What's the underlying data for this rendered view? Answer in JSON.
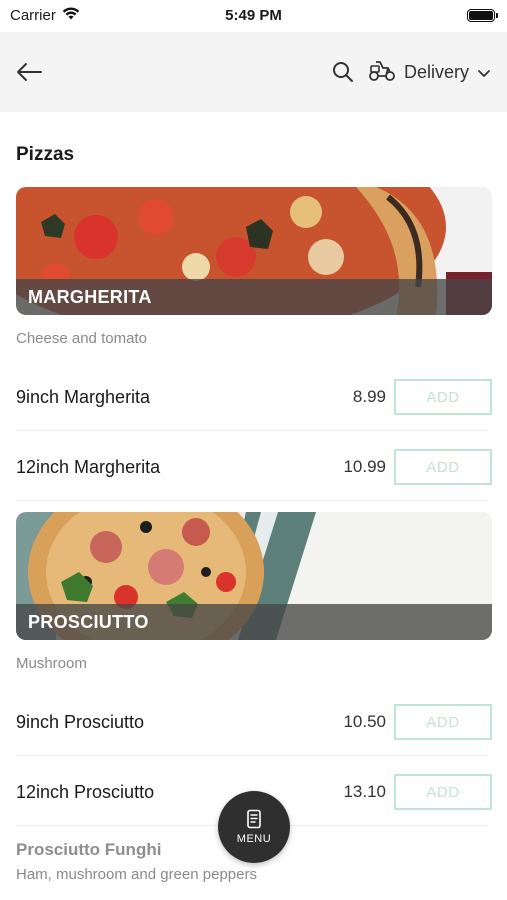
{
  "status": {
    "carrier": "Carrier",
    "time": "5:49 PM"
  },
  "nav": {
    "delivery_label": "Delivery"
  },
  "section": {
    "title": "Pizzas"
  },
  "cards": [
    {
      "title": "MARGHERITA",
      "description": "Cheese and tomato",
      "items": [
        {
          "name": "9inch Margherita",
          "price": "8.99",
          "add": "ADD"
        },
        {
          "name": "12inch Margherita",
          "price": "10.99",
          "add": "ADD"
        }
      ]
    },
    {
      "title": "PROSCIUTTO",
      "description": "Mushroom",
      "items": [
        {
          "name": "9inch Prosciutto",
          "price": "10.50",
          "add": "ADD"
        },
        {
          "name": "12inch Prosciutto",
          "price": "13.10",
          "add": "ADD"
        }
      ]
    }
  ],
  "next_product": {
    "name": "Prosciutto Funghi",
    "description": "Ham, mushroom and green peppers"
  },
  "fab": {
    "label": "MENU"
  },
  "colors": {
    "accent_border": "#bfe5d3",
    "nav_bg": "#f4f4f4",
    "fab_bg": "#2f2f2f"
  },
  "icons": [
    "wifi-icon",
    "battery-icon",
    "back-arrow-icon",
    "search-icon",
    "scooter-icon",
    "chevron-down-icon",
    "menu-book-icon"
  ]
}
